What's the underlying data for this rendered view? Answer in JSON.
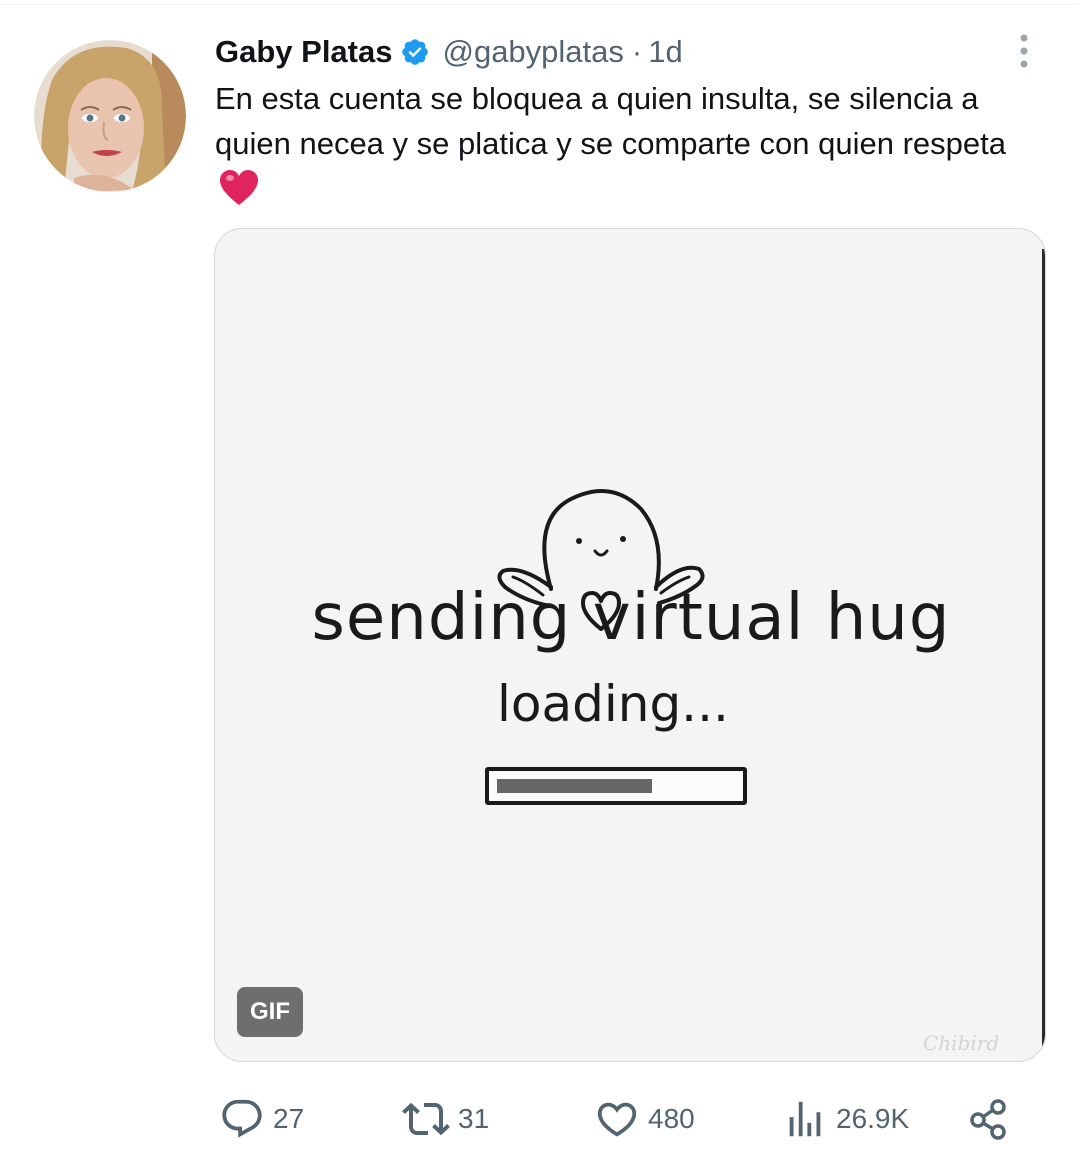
{
  "tweet": {
    "author": {
      "display_name": "Gaby Platas",
      "handle": "@gabyplatas",
      "verified": true,
      "avatar": "profile-photo"
    },
    "separator": "·",
    "time": "1d",
    "text": "En esta cuenta se bloquea a quien insulta, se silencia a quien necea y se platica y se comparte con quien respeta",
    "text_emoji": "red-heart",
    "media": {
      "type": "GIF",
      "badge_label": "GIF",
      "caption_text": "sending virtual hug",
      "loading_text": "loading...",
      "progress_fraction": 0.65,
      "watermark": "Chibird"
    },
    "actions": {
      "replies": {
        "icon": "reply-icon",
        "count": "27"
      },
      "retweets": {
        "icon": "retweet-icon",
        "count": "31"
      },
      "likes": {
        "icon": "like-icon",
        "count": "480"
      },
      "views": {
        "icon": "views-icon",
        "count": "26.9K"
      },
      "share": {
        "icon": "share-icon"
      }
    }
  },
  "colors": {
    "text_primary": "#0f1419",
    "text_secondary": "#536471",
    "verified_blue": "#1d9bf0",
    "heart_red": "#e0245e",
    "gif_badge_bg": "#6e6e6e"
  }
}
